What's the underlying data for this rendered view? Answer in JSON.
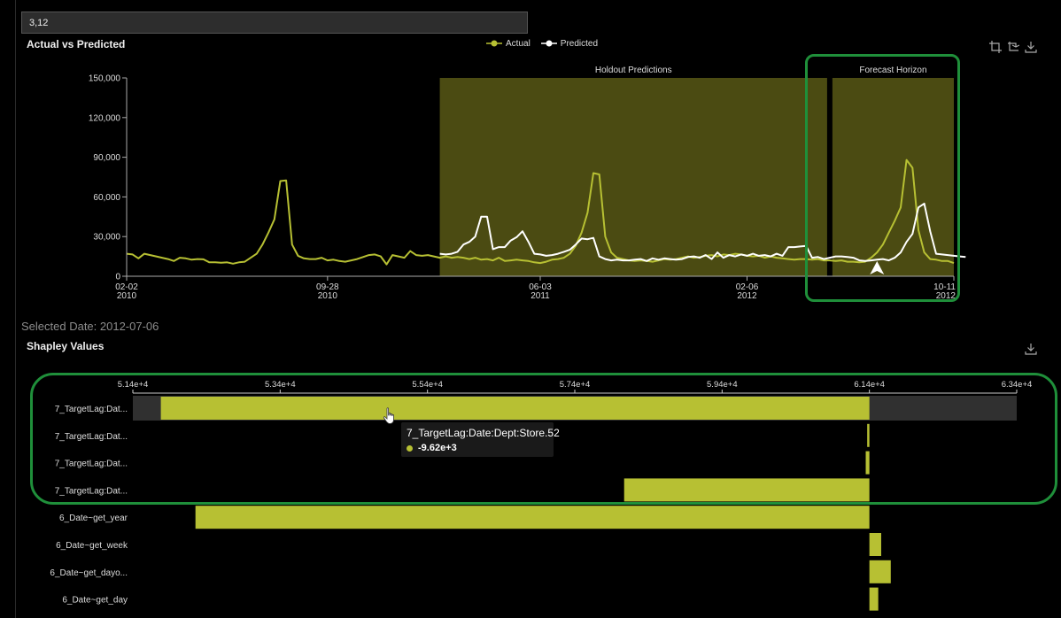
{
  "filter": {
    "value": "3,12"
  },
  "top_chart": {
    "title": "Actual vs Predicted",
    "legend": [
      {
        "label": "Actual",
        "color": "#b7c033"
      },
      {
        "label": "Predicted",
        "color": "#ffffff"
      }
    ],
    "regions": {
      "holdout": "Holdout Predictions",
      "forecast": "Forecast Horizon"
    },
    "toolbar_icons": [
      "crop-icon",
      "reset-icon",
      "download-icon"
    ]
  },
  "selected_date": "Selected Date: 2012-07-06",
  "shapley": {
    "title": "Shapley Values",
    "toolbar_icons": [
      "download-icon"
    ],
    "tooltip": {
      "feature": "7_TargetLag:Date:Dept:Store.52",
      "value": "-9.62e+3"
    }
  },
  "chart_data": [
    {
      "type": "line",
      "title": "Actual vs Predicted",
      "x_tick_labels": [
        [
          "02-02",
          "2010"
        ],
        [
          "09-28",
          "2010"
        ],
        [
          "06-03",
          "2011"
        ],
        [
          "02-06",
          "2012"
        ],
        [
          "10-11",
          "2012"
        ]
      ],
      "y_tick_labels": [
        "0",
        "30,000",
        "60,000",
        "90,000",
        "120,000",
        "150,000"
      ],
      "ylim": [
        0,
        150000
      ],
      "x_week_range": [
        0,
        140
      ],
      "bands": [
        {
          "label": "Holdout Predictions",
          "x": [
            53,
            119
          ]
        },
        {
          "label": "Forecast Horizon",
          "x": [
            119,
            140
          ]
        }
      ],
      "series": [
        {
          "name": "Actual",
          "color": "#b7c033",
          "x_start": 0,
          "values": [
            17000,
            16500,
            13500,
            17000,
            16000,
            15000,
            14000,
            13000,
            11500,
            14000,
            13500,
            12500,
            13000,
            12800,
            10500,
            10500,
            10200,
            10500,
            9500,
            10500,
            11000,
            14000,
            17000,
            24000,
            33000,
            43000,
            72000,
            72500,
            24000,
            15500,
            13500,
            13000,
            13000,
            14000,
            12000,
            12500,
            11500,
            11000,
            12000,
            13000,
            14500,
            16000,
            16500,
            15000,
            9000,
            16000,
            15000,
            14000,
            19000,
            16000,
            15500,
            16000,
            15000,
            14000,
            15000,
            14000,
            14500,
            14000,
            13000,
            14000,
            12500,
            13000,
            12000,
            14000,
            11500,
            12000,
            12500,
            12000,
            11500,
            10500,
            10000,
            11000,
            12500,
            13000,
            14000,
            17000,
            23000,
            33000,
            48000,
            78000,
            77000,
            30000,
            18000,
            14000,
            13000,
            12000,
            11500,
            12000,
            11500,
            11000,
            12000,
            13000,
            12500,
            13000,
            14000,
            15000,
            14000,
            14500,
            15500,
            16000,
            15000,
            16500,
            16000,
            17000,
            16500,
            15500,
            15000,
            15500,
            14000,
            15000,
            14000,
            13500,
            13000,
            12500,
            13000,
            13000,
            12500,
            13000,
            12000,
            12000,
            11500,
            12000,
            11000,
            11000,
            10500,
            11000,
            14000,
            18000,
            24000,
            33000,
            42000,
            52000,
            88000,
            82000,
            35000,
            18000,
            13000,
            12500,
            11500,
            11500,
            10000
          ]
        },
        {
          "name": "Predicted",
          "color": "#ffffff",
          "x_start": 53,
          "values": [
            17000,
            16500,
            17000,
            18500,
            24000,
            26000,
            30000,
            45000,
            45000,
            20500,
            22000,
            22000,
            27000,
            29500,
            34000,
            26000,
            17000,
            16500,
            15500,
            16000,
            17000,
            18500,
            20000,
            24000,
            28500,
            28000,
            29000,
            15000,
            13000,
            12000,
            12500,
            12000,
            12000,
            12500,
            13000,
            11500,
            13500,
            12500,
            13500,
            13000,
            12500,
            13000,
            14500,
            15000,
            14000,
            16000,
            13000,
            18000,
            14000,
            16000,
            15000,
            16500,
            15500,
            17000,
            15500,
            16000,
            15000,
            17000,
            15500,
            22000,
            22000,
            22500,
            23000,
            14000,
            14500,
            13000,
            14000,
            15000,
            15000,
            14500,
            14000,
            12000,
            11500,
            12000,
            12500,
            13000,
            12000,
            14000,
            18000,
            26000,
            32000,
            52000,
            55000,
            34000,
            17000,
            16500,
            16000,
            15500,
            15000,
            14500
          ]
        }
      ],
      "marker": {
        "x": 127
      }
    },
    {
      "type": "bar",
      "title": "Shapley Values",
      "x_tick_labels": [
        "5.14e+4",
        "5.34e+4",
        "5.54e+4",
        "5.74e+4",
        "5.94e+4",
        "6.14e+4",
        "6.34e+4"
      ],
      "xlim": [
        51400,
        63400
      ],
      "baseline": 61400,
      "categories": [
        "7_TargetLag:Dat...",
        "7_TargetLag:Dat...",
        "7_TargetLag:Dat...",
        "7_TargetLag:Dat...",
        "6_Date~get_year",
        "6_Date~get_week",
        "6_Date~get_dayo...",
        "6_Date~get_day"
      ],
      "values": [
        -9620,
        -30,
        -50,
        -3330,
        -9150,
        160,
        290,
        120
      ],
      "highlighted_row": 0
    }
  ]
}
